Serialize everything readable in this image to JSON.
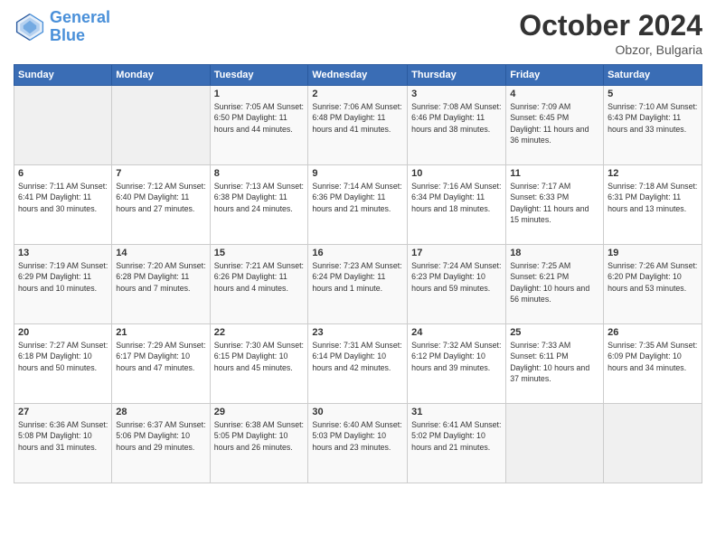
{
  "header": {
    "logo_line1": "General",
    "logo_line2": "Blue",
    "month": "October 2024",
    "location": "Obzor, Bulgaria"
  },
  "weekdays": [
    "Sunday",
    "Monday",
    "Tuesday",
    "Wednesday",
    "Thursday",
    "Friday",
    "Saturday"
  ],
  "weeks": [
    [
      {
        "day": "",
        "info": ""
      },
      {
        "day": "",
        "info": ""
      },
      {
        "day": "1",
        "info": "Sunrise: 7:05 AM\nSunset: 6:50 PM\nDaylight: 11 hours and 44 minutes."
      },
      {
        "day": "2",
        "info": "Sunrise: 7:06 AM\nSunset: 6:48 PM\nDaylight: 11 hours and 41 minutes."
      },
      {
        "day": "3",
        "info": "Sunrise: 7:08 AM\nSunset: 6:46 PM\nDaylight: 11 hours and 38 minutes."
      },
      {
        "day": "4",
        "info": "Sunrise: 7:09 AM\nSunset: 6:45 PM\nDaylight: 11 hours and 36 minutes."
      },
      {
        "day": "5",
        "info": "Sunrise: 7:10 AM\nSunset: 6:43 PM\nDaylight: 11 hours and 33 minutes."
      }
    ],
    [
      {
        "day": "6",
        "info": "Sunrise: 7:11 AM\nSunset: 6:41 PM\nDaylight: 11 hours and 30 minutes."
      },
      {
        "day": "7",
        "info": "Sunrise: 7:12 AM\nSunset: 6:40 PM\nDaylight: 11 hours and 27 minutes."
      },
      {
        "day": "8",
        "info": "Sunrise: 7:13 AM\nSunset: 6:38 PM\nDaylight: 11 hours and 24 minutes."
      },
      {
        "day": "9",
        "info": "Sunrise: 7:14 AM\nSunset: 6:36 PM\nDaylight: 11 hours and 21 minutes."
      },
      {
        "day": "10",
        "info": "Sunrise: 7:16 AM\nSunset: 6:34 PM\nDaylight: 11 hours and 18 minutes."
      },
      {
        "day": "11",
        "info": "Sunrise: 7:17 AM\nSunset: 6:33 PM\nDaylight: 11 hours and 15 minutes."
      },
      {
        "day": "12",
        "info": "Sunrise: 7:18 AM\nSunset: 6:31 PM\nDaylight: 11 hours and 13 minutes."
      }
    ],
    [
      {
        "day": "13",
        "info": "Sunrise: 7:19 AM\nSunset: 6:29 PM\nDaylight: 11 hours and 10 minutes."
      },
      {
        "day": "14",
        "info": "Sunrise: 7:20 AM\nSunset: 6:28 PM\nDaylight: 11 hours and 7 minutes."
      },
      {
        "day": "15",
        "info": "Sunrise: 7:21 AM\nSunset: 6:26 PM\nDaylight: 11 hours and 4 minutes."
      },
      {
        "day": "16",
        "info": "Sunrise: 7:23 AM\nSunset: 6:24 PM\nDaylight: 11 hours and 1 minute."
      },
      {
        "day": "17",
        "info": "Sunrise: 7:24 AM\nSunset: 6:23 PM\nDaylight: 10 hours and 59 minutes."
      },
      {
        "day": "18",
        "info": "Sunrise: 7:25 AM\nSunset: 6:21 PM\nDaylight: 10 hours and 56 minutes."
      },
      {
        "day": "19",
        "info": "Sunrise: 7:26 AM\nSunset: 6:20 PM\nDaylight: 10 hours and 53 minutes."
      }
    ],
    [
      {
        "day": "20",
        "info": "Sunrise: 7:27 AM\nSunset: 6:18 PM\nDaylight: 10 hours and 50 minutes."
      },
      {
        "day": "21",
        "info": "Sunrise: 7:29 AM\nSunset: 6:17 PM\nDaylight: 10 hours and 47 minutes."
      },
      {
        "day": "22",
        "info": "Sunrise: 7:30 AM\nSunset: 6:15 PM\nDaylight: 10 hours and 45 minutes."
      },
      {
        "day": "23",
        "info": "Sunrise: 7:31 AM\nSunset: 6:14 PM\nDaylight: 10 hours and 42 minutes."
      },
      {
        "day": "24",
        "info": "Sunrise: 7:32 AM\nSunset: 6:12 PM\nDaylight: 10 hours and 39 minutes."
      },
      {
        "day": "25",
        "info": "Sunrise: 7:33 AM\nSunset: 6:11 PM\nDaylight: 10 hours and 37 minutes."
      },
      {
        "day": "26",
        "info": "Sunrise: 7:35 AM\nSunset: 6:09 PM\nDaylight: 10 hours and 34 minutes."
      }
    ],
    [
      {
        "day": "27",
        "info": "Sunrise: 6:36 AM\nSunset: 5:08 PM\nDaylight: 10 hours and 31 minutes."
      },
      {
        "day": "28",
        "info": "Sunrise: 6:37 AM\nSunset: 5:06 PM\nDaylight: 10 hours and 29 minutes."
      },
      {
        "day": "29",
        "info": "Sunrise: 6:38 AM\nSunset: 5:05 PM\nDaylight: 10 hours and 26 minutes."
      },
      {
        "day": "30",
        "info": "Sunrise: 6:40 AM\nSunset: 5:03 PM\nDaylight: 10 hours and 23 minutes."
      },
      {
        "day": "31",
        "info": "Sunrise: 6:41 AM\nSunset: 5:02 PM\nDaylight: 10 hours and 21 minutes."
      },
      {
        "day": "",
        "info": ""
      },
      {
        "day": "",
        "info": ""
      }
    ]
  ]
}
